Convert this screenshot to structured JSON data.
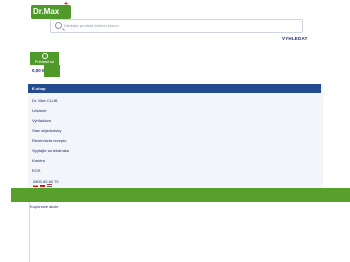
{
  "header": {
    "logo_text": "Dr.Max",
    "logo_mark": "+",
    "search_placeholder": "Hledejte produkt dobrou cenou",
    "search_button": "VYHLEDAT",
    "login_label": "Prihlásit se",
    "cart_price": "0,00 €"
  },
  "menu": {
    "items": [
      "E-shop",
      "Dr. Max CLUB",
      "Lekárne",
      "Vyhľadáva",
      "Stav objednávky",
      "Rezervácia receptu",
      "Spýtajte sa lekárnika",
      "Kariéra",
      "EOS"
    ],
    "phone": "0800 60 60 70"
  },
  "footer": {
    "link": "Kupónové akcie"
  },
  "colors": {
    "brand_green": "#56a02b",
    "nav_blue": "#244a8f",
    "text_navy": "#1d2c6b"
  },
  "icons": {
    "search": "search-icon",
    "user": "user-icon",
    "flags": [
      "cz-flag-icon",
      "sk-flag-icon",
      "hu-flag-icon"
    ]
  }
}
